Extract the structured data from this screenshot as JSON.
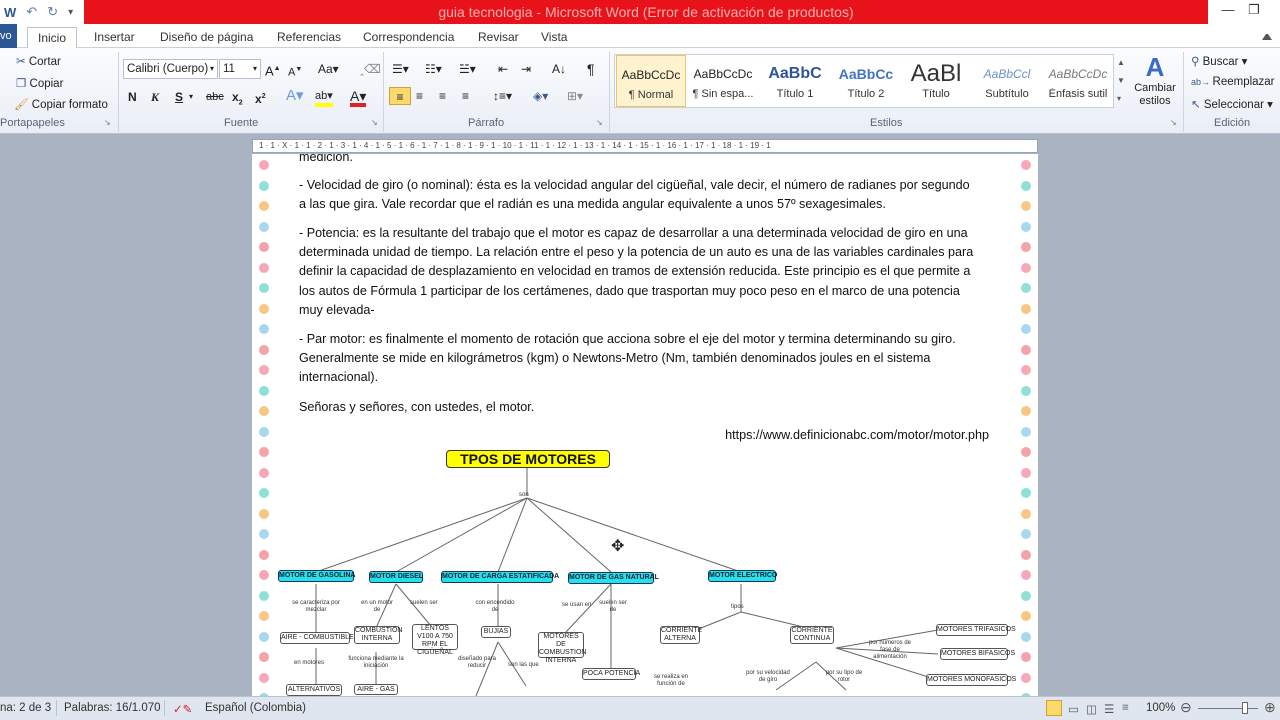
{
  "window": {
    "title": "guia tecnologia - Microsoft Word (Error de activación de productos)"
  },
  "ribbon_tabs": {
    "file": "vo",
    "items": [
      "Inicio",
      "Insertar",
      "Diseño de página",
      "Referencias",
      "Correspondencia",
      "Revisar",
      "Vista"
    ]
  },
  "clipboard": {
    "cut": "Cortar",
    "copy": "Copiar",
    "format_painter": "Copiar formato",
    "label": "Portapapeles"
  },
  "font": {
    "name": "Calibri (Cuerpo)",
    "size": "11",
    "label": "Fuente"
  },
  "paragraph": {
    "label": "Párrafo"
  },
  "styles": {
    "label": "Estilos",
    "items": [
      {
        "sample": "AaBbCcDc",
        "name": "¶ Normal"
      },
      {
        "sample": "AaBbCcDc",
        "name": "¶ Sin espa..."
      },
      {
        "sample": "AaBbC",
        "name": "Título 1"
      },
      {
        "sample": "AaBbCc",
        "name": "Título 2"
      },
      {
        "sample": "AaBl",
        "name": "Título"
      },
      {
        "sample": "AaBbCcl",
        "name": "Subtítulo"
      },
      {
        "sample": "AaBbCcDc",
        "name": "Énfasis sutil"
      }
    ],
    "change_styles": "Cambiar estilos"
  },
  "editing": {
    "find": "Buscar",
    "replace": "Reemplazar",
    "select": "Seleccionar",
    "label": "Edición"
  },
  "ruler_text": "1 · 1 · X · 1 · 1 · 2 · 1 · 3 · 1 · 4 · 1 · 5 · 1 · 6 · 1 · 7 · 1 · 8 · 1 · 9 · 1 · 10 · 1 · 11 · 1 · 12 · 1 · 13 · 1 · 14 · 1 · 15 · 1 · 16 · 1 · 17 · 1 · 18 · 1 · 19 · 1",
  "document": {
    "top_cut": "medición.",
    "para1": "- Velocidad de giro (o nominal): ésta es la velocidad angular del cigüeñal, vale decir, el número de radianes por segundo a las que gira. Vale recordar que el radián es una medida angular equivalente a unos 57º sexagesimales.",
    "para2": "- Potencia: es la resultante del trabajo que el motor es capaz de desarrollar a una determinada velocidad de giro en una determinada unidad de tiempo. La relación entre el peso y la potencia de un auto es una de las variables cardinales para definir la capacidad de desplazamiento en velocidad en tramos de extensión reducida. Este principio es el que permite a los autos de Fórmula 1 participar de los certámenes, dado que trasportan muy poco peso en el marco de una potencia muy elevada-",
    "para3": "- Par motor: es finalmente el momento de rotación que acciona sobre el eje del motor y termina determinando su giro. Generalmente se mide en kilográmetros (kgm) o Newtons-Metro (Nm, también denominados joules en el sistema internacional).",
    "para4": "Señoras y señores, con ustedes, el motor.",
    "url": "https://www.definicionabc.com/motor/motor.php"
  },
  "concept_map": {
    "title": "TPOS DE MOTORES",
    "root_link": "son",
    "categories": [
      "MOTOR DE GASOLINA",
      "MOTOR DIESEL",
      "MOTOR DE CARGA ESTATIFICADA",
      "MOTOR DE GAS NATURAL",
      "MOTOR ELECTRICO"
    ],
    "labels": {
      "gasolina_1": "se caracteriza por mezclar",
      "gasolina_2": "en motores",
      "diesel_1": "en un motor de",
      "diesel_2": "suelen ser",
      "diesel_3": "funciona mediante la iniciación",
      "carga_1": "con encendido de",
      "carga_2": "diseñado para reducir",
      "carga_3": "son las que",
      "gas_1": "se usan en",
      "gas_2": "suelen ser de",
      "elec_1": "tipos",
      "elec_2": "se realiza en función de",
      "elec_3": "por su velocidad de giro",
      "elec_4": "por su tipo de rotor",
      "elec_5": "por números de fase de alimentación"
    },
    "nodes": {
      "aire_combustible": "AIRE - COMBUSTIBLE",
      "alternativos": "ALTERNATIVOS",
      "combustion_interna": "COMBUSTION INTERNA",
      "lentos": "LENTOS V100 A 750 RPM EL CIGÜEÑAL",
      "aire_gas": "AIRE - GAS",
      "bujias": "BUJIAS",
      "motores_combustion": "MOTORES DE COMBUSTION INTERNA",
      "poca_potencia": "POCA POTENCIA",
      "corriente_alterna": "CORRIENTE ALTERNA",
      "corriente_continua": "CORRIENTE CONTINUA",
      "trifasicos": "MOTORES TRIFASICOS",
      "bifasicos": "MOTORES BIFASICOS",
      "monofasicos": "MOTORES MONOFASICOS"
    }
  },
  "status": {
    "page": "na: 2 de 3",
    "words": "Palabras: 16/1.070",
    "language": "Español (Colombia)",
    "zoom": "100%"
  },
  "colors": {
    "title_bar": "#e8131a",
    "map_title_bg": "#ffff00",
    "map_node": "#27e0ea"
  }
}
